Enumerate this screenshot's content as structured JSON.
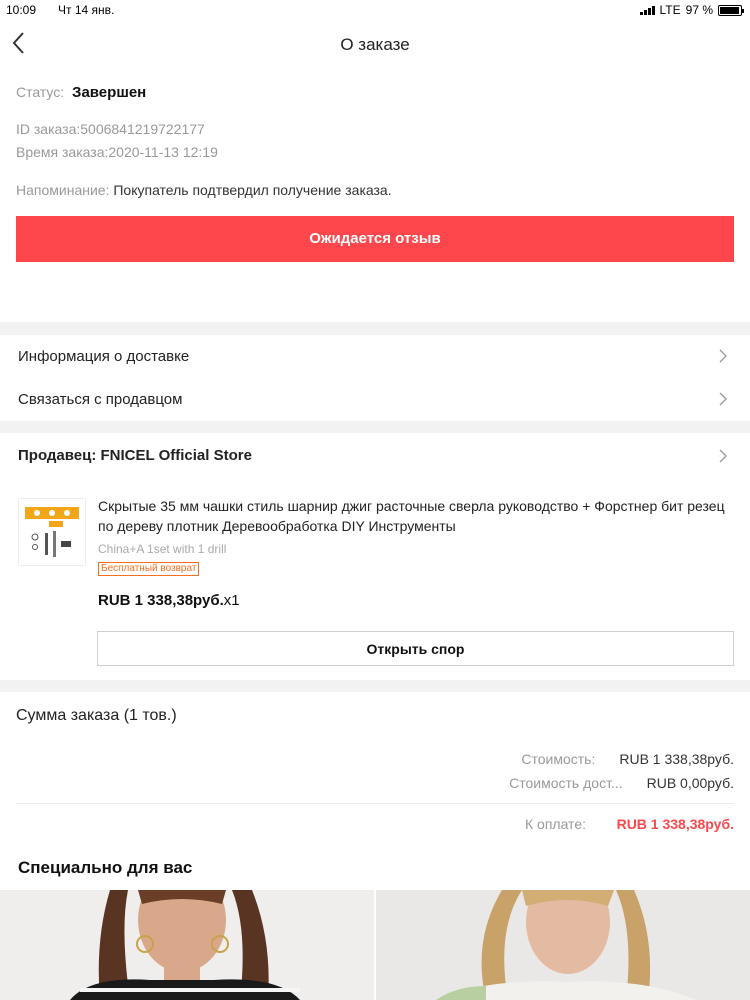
{
  "status_bar": {
    "time": "10:09",
    "day": "Чт 14 янв.",
    "network": "LTE",
    "battery": "97 %",
    "battery_level": 0.97
  },
  "nav": {
    "title": "О заказе",
    "back_icon": "chevron-left-icon"
  },
  "order": {
    "status_label": "Статус:",
    "status_value": "Завершен",
    "id_line": "ID заказа:5006841219722177",
    "time_line": "Время заказа:2020-11-13 12:19",
    "reminder_label": "Напоминание:",
    "reminder_value": "Покупатель подтвердил получение заказа.",
    "review_button": "Ожидается отзыв"
  },
  "links": {
    "delivery": "Информация о доставке",
    "contact_seller": "Связаться с продавцом"
  },
  "seller": {
    "label": "Продавец: FNICEL Official Store"
  },
  "product": {
    "title": "Скрытые 35 мм чашки стиль шарнир джиг расточные сверла руководство + Форстнер бит резец по дереву плотник Деревообработка DIY Инструменты",
    "variant": "China+A 1set with 1 drill",
    "badge": "Бесплатный возврат",
    "price": "RUB 1 338,38руб.",
    "quantity": "x1",
    "dispute_button": "Открыть спор"
  },
  "summary": {
    "title": "Сумма заказа (1 тов.)",
    "cost_label": "Стоимость:",
    "cost_value": "RUB 1 338,38руб.",
    "shipping_label": "Стоимость дост...",
    "shipping_value": "RUB 0,00руб.",
    "pay_label": "К оплате:",
    "pay_value": "RUB 1 338,38руб."
  },
  "recommend": {
    "title": "Специально для вас"
  },
  "colors": {
    "accent": "#fd474d",
    "badge": "#f37020",
    "separator": "#f2f2f2"
  }
}
